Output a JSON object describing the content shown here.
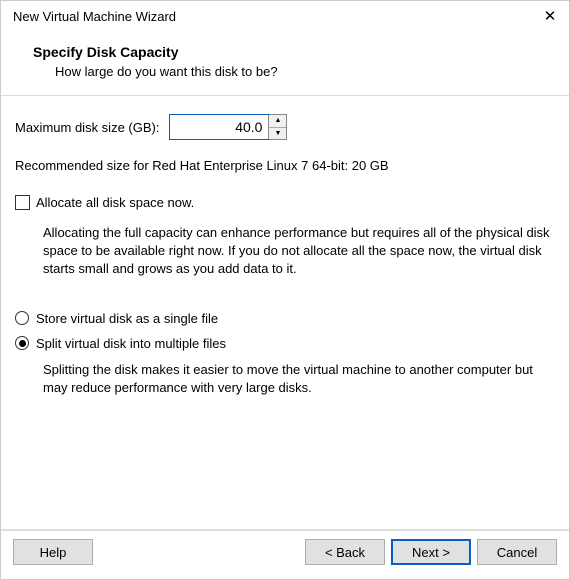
{
  "window": {
    "title": "New Virtual Machine Wizard"
  },
  "header": {
    "title": "Specify Disk Capacity",
    "subtitle": "How large do you want this disk to be?"
  },
  "disk": {
    "size_label": "Maximum disk size (GB):",
    "size_value": "40.0",
    "recommended": "Recommended size for Red Hat Enterprise Linux 7 64-bit: 20 GB"
  },
  "allocate": {
    "label": "Allocate all disk space now.",
    "checked": false,
    "explain": "Allocating the full capacity can enhance performance but requires all of the physical disk space to be available right now. If you do not allocate all the space now, the virtual disk starts small and grows as you add data to it."
  },
  "storage": {
    "single_label": "Store virtual disk as a single file",
    "split_label": "Split virtual disk into multiple files",
    "selected": "split",
    "split_explain": "Splitting the disk makes it easier to move the virtual machine to another computer but may reduce performance with very large disks."
  },
  "buttons": {
    "help": "Help",
    "back": "< Back",
    "next": "Next >",
    "cancel": "Cancel"
  }
}
